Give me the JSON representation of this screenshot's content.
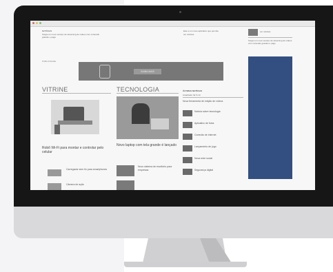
{
  "site": {
    "top_notice_title": "NOTÍCIAS",
    "top_notice_text": "Surgiu um novo serviço de streaming de vídeos com conteúdo gratuito e pago",
    "top_right_text": "Este é um novo aplicativo que permite",
    "top_right_sub": "ver notícias",
    "advertising_label": "PUBLICIDADE",
    "banner_cta": "SAIBA MAIS",
    "sections": [
      {
        "title": "VITRINE",
        "lead": "Robô Wi-Fi para montar e controlar pelo celular",
        "list": [
          {
            "text": "Carregador sem fio para smartphones"
          },
          {
            "text": "Câmera de ação"
          }
        ]
      },
      {
        "title": "TECNOLOGIA",
        "lead": "Novo laptop com tela grande é lançado",
        "list": [
          {
            "text": "Novo sistema de escritório para empresas"
          }
        ]
      },
      {
        "title": "ÚLTIMAS NOTÍCIAS",
        "sub": "Atualizado há 5 min",
        "lead": "Nova ferramenta de edição de vídeos",
        "list": [
          {
            "text": "Notícia sobre tecnologia"
          },
          {
            "text": "Aplicativo de fotos"
          },
          {
            "text": "Conexão de internet"
          },
          {
            "text": "Lançamento de jogo"
          },
          {
            "text": "Nova rede social"
          },
          {
            "text": "Segurança digital"
          }
        ]
      }
    ]
  },
  "colors": {
    "sidebar": "#2f4f8a",
    "bezel": "#161616",
    "chin": "#d9d9db"
  }
}
